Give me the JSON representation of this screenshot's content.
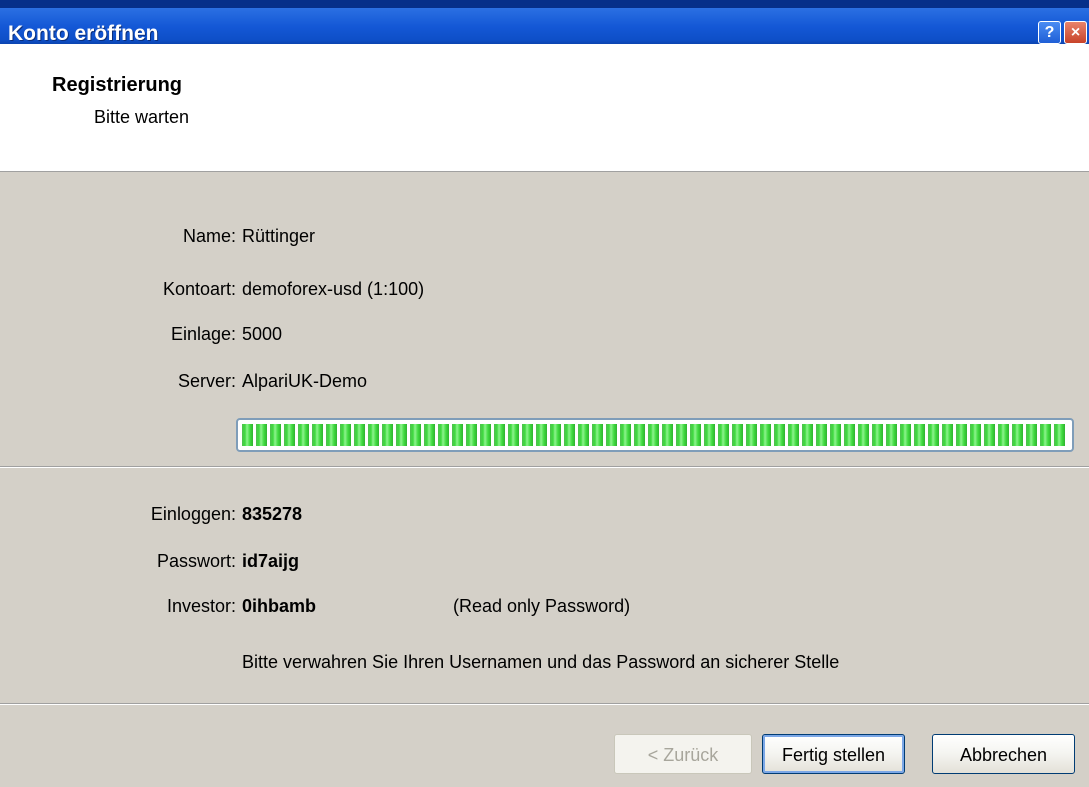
{
  "window": {
    "title": "Konto eröffnen",
    "help_glyph": "?",
    "close_glyph": "×"
  },
  "header": {
    "title": "Registrierung",
    "subtitle": "Bitte warten"
  },
  "details": [
    {
      "label": "Name:",
      "value": "Rüttinger"
    },
    {
      "label": "Kontoart:",
      "value": "demoforex-usd (1:100)"
    },
    {
      "label": "Einlage:",
      "value": "5000"
    },
    {
      "label": "Server:",
      "value": "AlpariUK-Demo"
    }
  ],
  "progress": {
    "percent": 100,
    "fill_color": "#3fdb3f"
  },
  "credentials": [
    {
      "label": "Einloggen:",
      "value": "835278"
    },
    {
      "label": "Passwort:",
      "value": "id7aijg"
    },
    {
      "label": "Investor:",
      "value": "0ihbamb"
    }
  ],
  "investor_hint": "(Read only Password)",
  "note": "Bitte verwahren Sie Ihren Usernamen und das Password an sicherer Stelle",
  "buttons": {
    "back": "< Zurück",
    "finish": "Fertig stellen",
    "cancel": "Abbrechen"
  }
}
